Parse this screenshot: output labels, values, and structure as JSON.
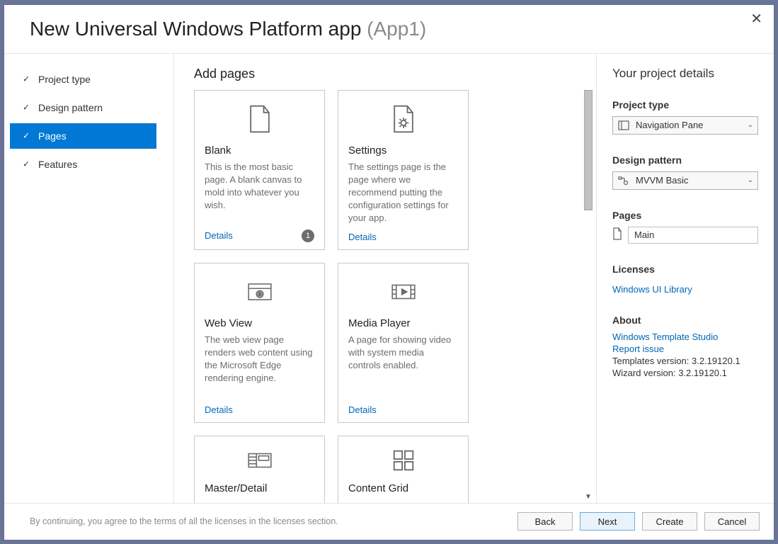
{
  "title_main": "New Universal Windows Platform app",
  "title_suffix": "(App1)",
  "nav": {
    "items": [
      {
        "label": "Project type"
      },
      {
        "label": "Design pattern"
      },
      {
        "label": "Pages"
      },
      {
        "label": "Features"
      }
    ],
    "active_index": 2
  },
  "center": {
    "heading": "Add pages",
    "cards": [
      {
        "title": "Blank",
        "desc": "This is the most basic page. A blank canvas to mold into whatever you wish.",
        "details": "Details",
        "badge": "1"
      },
      {
        "title": "Settings",
        "desc": "The settings page is the page where we recommend putting the configuration settings for your app.",
        "details": "Details"
      },
      {
        "title": "Web View",
        "desc": "The web view page renders web content using the Microsoft Edge rendering engine.",
        "details": "Details"
      },
      {
        "title": "Media Player",
        "desc": "A page for showing video with system media controls enabled.",
        "details": "Details"
      },
      {
        "title": "Master/Detail",
        "desc": ""
      },
      {
        "title": "Content Grid",
        "desc": ""
      }
    ]
  },
  "right": {
    "heading": "Your project details",
    "project_type_label": "Project type",
    "project_type_value": "Navigation Pane",
    "design_pattern_label": "Design pattern",
    "design_pattern_value": "MVVM Basic",
    "pages_label": "Pages",
    "page_main": "Main",
    "licenses_label": "Licenses",
    "licenses_link": "Windows UI Library",
    "about_label": "About",
    "about_link1": "Windows Template Studio",
    "about_link2": "Report issue",
    "templates_version": "Templates version: 3.2.19120.1",
    "wizard_version": "Wizard version: 3.2.19120.1"
  },
  "footer": {
    "note": "By continuing, you agree to the terms of all the licenses in the licenses section.",
    "back": "Back",
    "next": "Next",
    "create": "Create",
    "cancel": "Cancel"
  }
}
